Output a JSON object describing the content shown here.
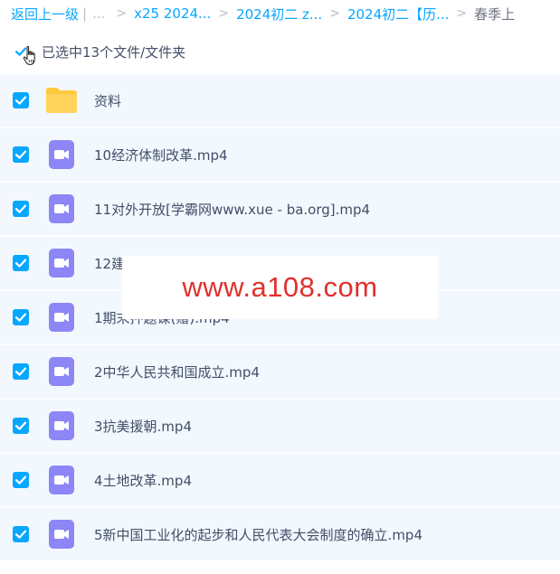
{
  "breadcrumb": {
    "back": "返回上一级",
    "pipe": "|",
    "ellipsis": "...",
    "items": [
      {
        "label": "x25 2024..."
      },
      {
        "label": "2024初二 z..."
      },
      {
        "label": "2024初二【历..."
      }
    ],
    "current": "春季上",
    "separator": ">"
  },
  "selection": {
    "text": "已选中13个文件/文件夹"
  },
  "files": [
    {
      "name": "资料",
      "type": "folder",
      "checked": true
    },
    {
      "name": "10经济体制改革.mp4",
      "type": "video",
      "checked": true
    },
    {
      "name": "11对外开放[学霸网www.xue - ba.org].mp4",
      "type": "video",
      "checked": true
    },
    {
      "name": "12建",
      "type": "video",
      "checked": true
    },
    {
      "name": "1期末押题课(赠).mp4",
      "type": "video",
      "checked": true
    },
    {
      "name": "2中华人民共和国成立.mp4",
      "type": "video",
      "checked": true
    },
    {
      "name": "3抗美援朝.mp4",
      "type": "video",
      "checked": true
    },
    {
      "name": "4土地改革.mp4",
      "type": "video",
      "checked": true
    },
    {
      "name": "5新中国工业化的起步和人民代表大会制度的确立.mp4",
      "type": "video",
      "checked": true
    }
  ],
  "watermark": {
    "text": "www.a108.com"
  },
  "colors": {
    "accent": "#06a7ff",
    "row_bg": "#f2f8fe",
    "folder": "#ffd35c",
    "video": "#8c86f6",
    "watermark": "#e0302d",
    "text": "#424e67"
  },
  "icons": {
    "folder": "folder-icon",
    "video": "video-file-icon",
    "check": "check-icon",
    "cursor": "hand-cursor-icon"
  }
}
